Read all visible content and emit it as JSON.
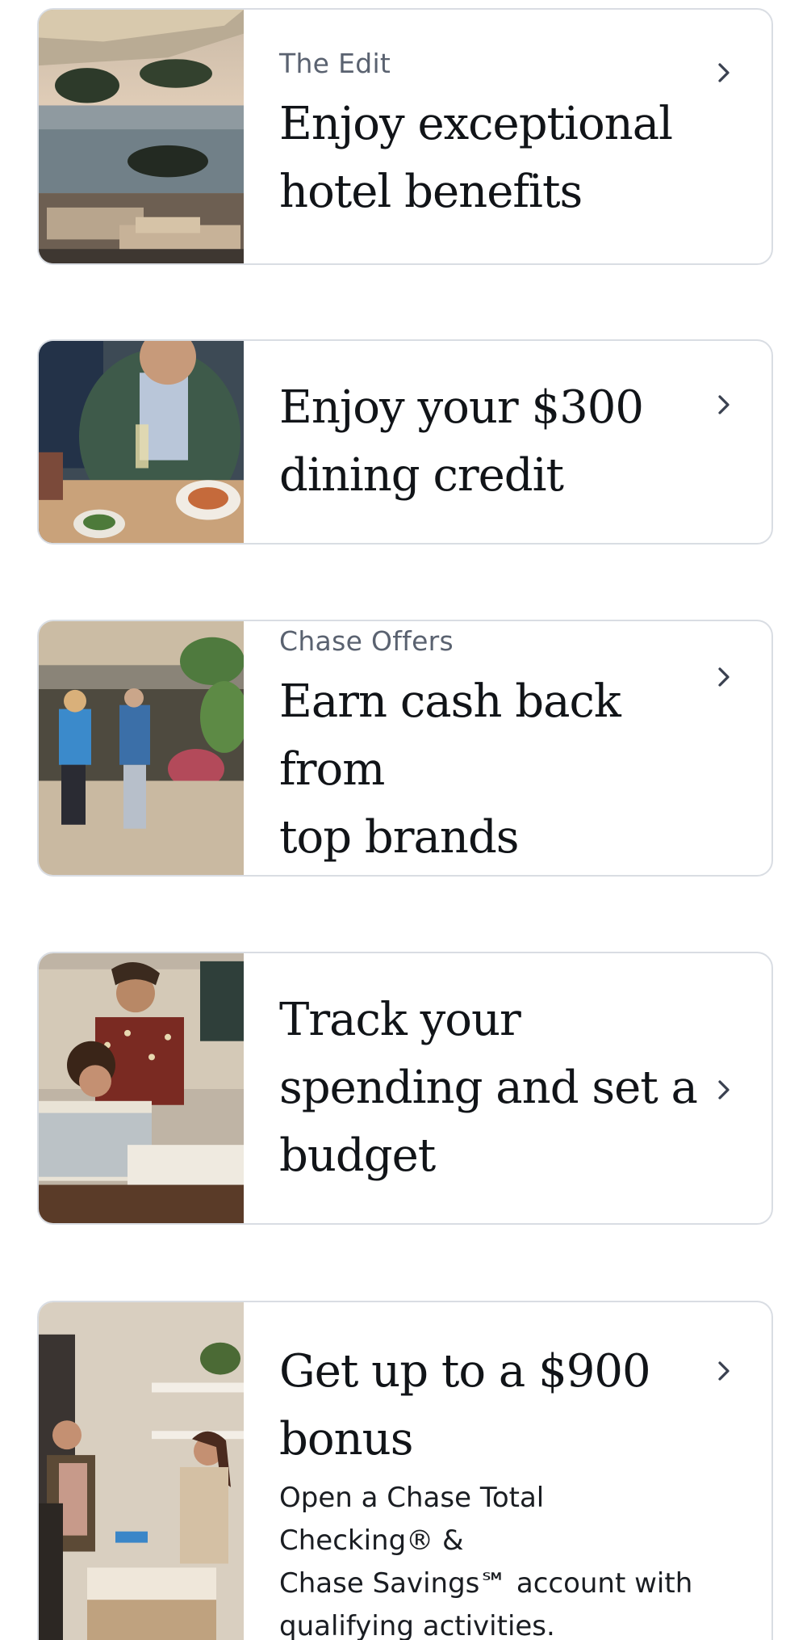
{
  "cards": [
    {
      "eyebrow": "The Edit",
      "title_lines": [
        "Enjoy exceptional",
        "hotel benefits"
      ],
      "image": "hotel-poolside-photo"
    },
    {
      "eyebrow": "",
      "title_lines": [
        "Enjoy your $300",
        "dining credit"
      ],
      "image": "dining-photo"
    },
    {
      "eyebrow": "Chase Offers",
      "title_lines": [
        "Earn cash back from",
        "top brands"
      ],
      "image": "shopping-street-photo"
    },
    {
      "eyebrow": "",
      "title_lines": [
        "Track your",
        "spending and set a",
        "budget"
      ],
      "image": "couple-budgeting-photo"
    },
    {
      "eyebrow": "",
      "title_lines": [
        "Get up to a $900",
        "bonus"
      ],
      "body_lines": [
        "Open a Chase Total Checking® &",
        "Chase Savings℠ account with",
        "qualifying activities."
      ],
      "image": "bank-branch-photo"
    }
  ],
  "icons": {
    "chevron": "chevron-right-icon"
  },
  "colors": {
    "border": "#d9dde3",
    "eyebrow": "#5a6270",
    "title": "#111418"
  }
}
